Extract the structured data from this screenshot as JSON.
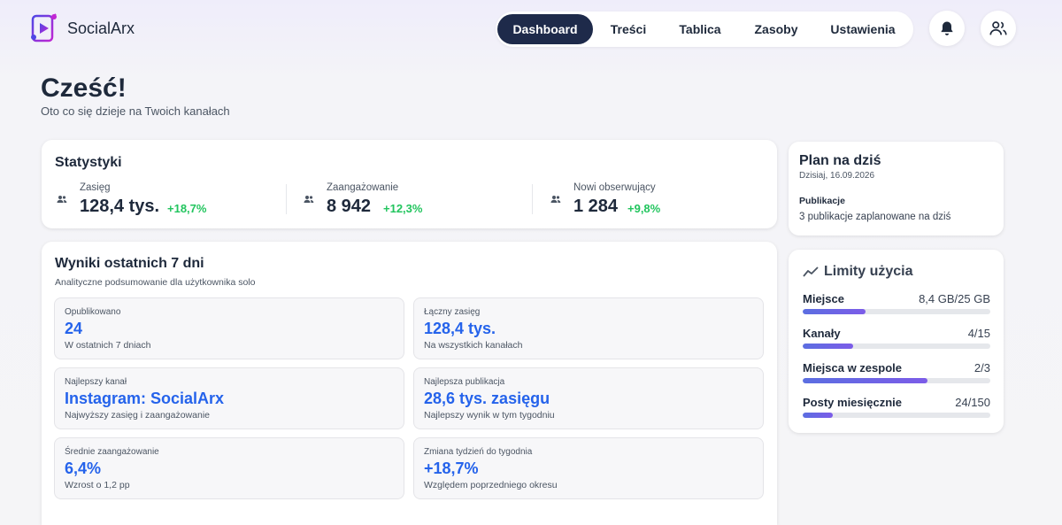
{
  "app": {
    "name": "SocialArx"
  },
  "nav": {
    "items": [
      {
        "label": "Dashboard",
        "active": true
      },
      {
        "label": "Treści",
        "active": false
      },
      {
        "label": "Tablica",
        "active": false
      },
      {
        "label": "Zasoby",
        "active": false
      },
      {
        "label": "Ustawienia",
        "active": false
      }
    ]
  },
  "header_icons": [
    "bell-icon",
    "users-icon"
  ],
  "greeting": {
    "title": "Cześć!",
    "subtitle": "Oto co się dzieje na Twoich kanałach"
  },
  "stats": {
    "title": "Statystyki",
    "items": [
      {
        "label": "Zasięg",
        "value": "128,4 tys.",
        "change": "+18,7%",
        "icon": "users-icon"
      },
      {
        "label": "Zaangażowanie",
        "value": "8 942",
        "change": "+12,3%",
        "icon": "users-icon"
      },
      {
        "label": "Nowi obserwujący",
        "value": "1 284",
        "change": "+9,8%",
        "icon": "users-icon"
      }
    ]
  },
  "results": {
    "title": "Wyniki ostatnich 7 dni",
    "subtitle": "Analityczne podsumowanie dla użytkownika solo",
    "tiles": [
      {
        "label": "Opublikowano",
        "value": "24",
        "sub": "W ostatnich 7 dniach"
      },
      {
        "label": "Łączny zasięg",
        "value": "128,4 tys.",
        "sub": "Na wszystkich kanałach"
      },
      {
        "label": "Najlepszy kanał",
        "value": "Instagram: SocialArx",
        "sub": "Najwyższy zasięg i zaangażowanie"
      },
      {
        "label": "Najlepsza publikacja",
        "value": "28,6 tys. zasięgu",
        "sub": "Najlepszy wynik w tym tygodniu"
      },
      {
        "label": "Średnie zaangażowanie",
        "value": "6,4%",
        "sub": "Wzrost o 1,2 pp"
      },
      {
        "label": "Zmiana tydzień do tygodnia",
        "value": "+18,7%",
        "sub": "Względem poprzedniego okresu"
      }
    ]
  },
  "plan": {
    "title": "Plan na dziś",
    "date": "Dzisiaj, 16.09.2026",
    "section_label": "Publikacje",
    "section_text": "3 publikacje zaplanowane na dziś"
  },
  "limits": {
    "title": "Limity użycia",
    "icon": "trend-line-icon",
    "items": [
      {
        "label": "Miejsce",
        "value": "8,4 GB/25 GB",
        "fraction": 0.336
      },
      {
        "label": "Kanały",
        "value": "4/15",
        "fraction": 0.267
      },
      {
        "label": "Miejsca w zespole",
        "value": "2/3",
        "fraction": 0.667
      },
      {
        "label": "Posty miesięcznie",
        "value": "24/150",
        "fraction": 0.16
      }
    ]
  },
  "colors": {
    "accent": "#2563eb",
    "positive": "#22c55e",
    "nav_active": "#1e2a4a",
    "bar_start": "#5b6ee1",
    "bar_end": "#7c5ce8"
  }
}
